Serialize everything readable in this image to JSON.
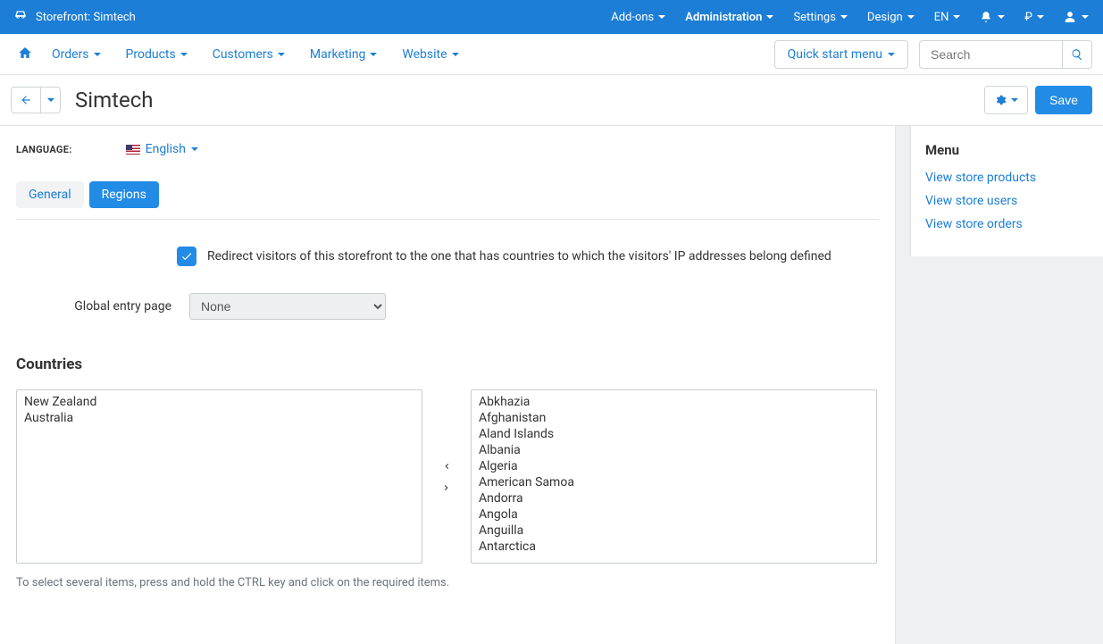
{
  "topbar": {
    "storefront_label": "Storefront: Simtech",
    "items": [
      "Add-ons",
      "Administration",
      "Settings",
      "Design"
    ],
    "active_index": 1,
    "lang": "EN",
    "currency": "₽"
  },
  "navbar": {
    "items": [
      "Orders",
      "Products",
      "Customers",
      "Marketing",
      "Website"
    ],
    "quick_start": "Quick start menu",
    "search_placeholder": "Search"
  },
  "titlebar": {
    "title": "Simtech",
    "save": "Save"
  },
  "sidebar": {
    "heading": "Menu",
    "links": [
      "View store products",
      "View store users",
      "View store orders"
    ]
  },
  "language": {
    "label": "LANGUAGE:",
    "value": "English"
  },
  "tabs": {
    "general": "General",
    "regions": "Regions"
  },
  "redirect": {
    "label": "Redirect visitors of this storefront to the one that has countries to which the visitors' IP addresses belong defined"
  },
  "global_entry": {
    "label": "Global entry page",
    "value": "None"
  },
  "countries": {
    "title": "Countries",
    "selected": [
      "New Zealand",
      "Australia"
    ],
    "available": [
      "Abkhazia",
      "Afghanistan",
      "Aland Islands",
      "Albania",
      "Algeria",
      "American Samoa",
      "Andorra",
      "Angola",
      "Anguilla",
      "Antarctica"
    ],
    "hint": "To select several items, press and hold the CTRL key and click on the required items."
  }
}
